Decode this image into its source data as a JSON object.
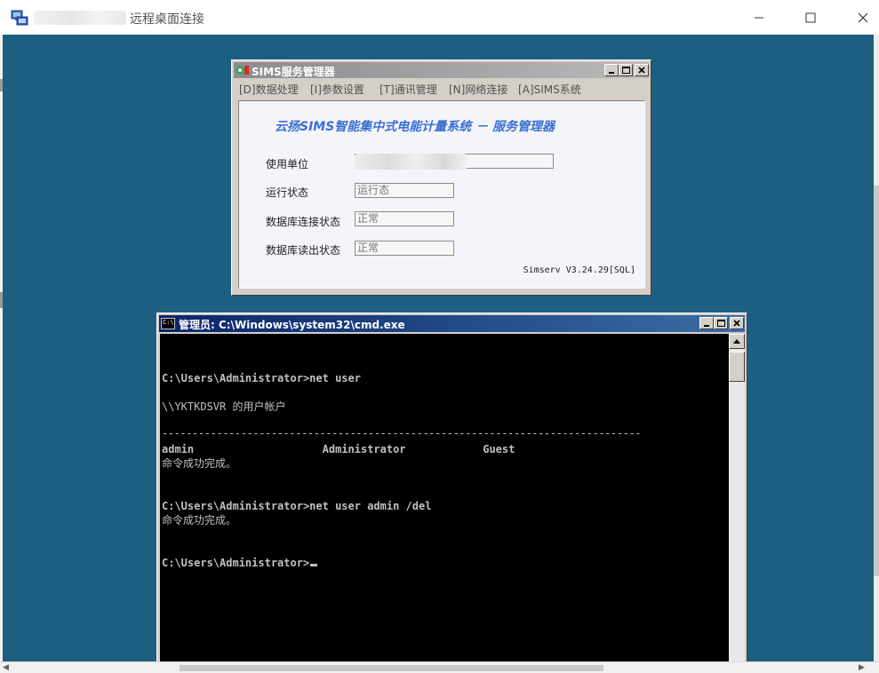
{
  "rdp": {
    "title": "远程桌面连接",
    "controls": {
      "minimize": "minimize",
      "maximize": "maximize",
      "close": "close"
    }
  },
  "sims": {
    "title": "SIMS服务管理器",
    "menu": [
      "[D]数据处理",
      "[I]参数设置",
      "[T]通讯管理",
      "[N]网络连接",
      "[A]SIMS系统"
    ],
    "heading": "云扬SIMS智能集中式电能计量系统 － 服务管理器",
    "fields": {
      "unit_label": "使用单位",
      "unit_value": "",
      "run_status_label": "运行状态",
      "run_status_value": "运行态",
      "db_connect_label": "数据库连接状态",
      "db_connect_value": "正常",
      "db_read_label": "数据库读出状态",
      "db_read_value": "正常"
    },
    "version": "Simserv V3.24.29[SQL]"
  },
  "cmd": {
    "title": "管理员: C:\\Windows\\system32\\cmd.exe",
    "lines": [
      "C:\\Users\\Administrator>net user",
      "\\\\YKTKDSVR 的用户帐户",
      "-------------------------------------------------------------------------------",
      "admin                    Administrator            Guest",
      "命令成功完成。",
      "C:\\Users\\Administrator>net user admin /del",
      "命令成功完成。",
      "C:\\Users\\Administrator>"
    ]
  },
  "colors": {
    "desktop": "#1c5f80",
    "cmd_title_start": "#0a246a",
    "cmd_title_end": "#3a6ea5",
    "sims_heading": "#3a6fd0"
  }
}
